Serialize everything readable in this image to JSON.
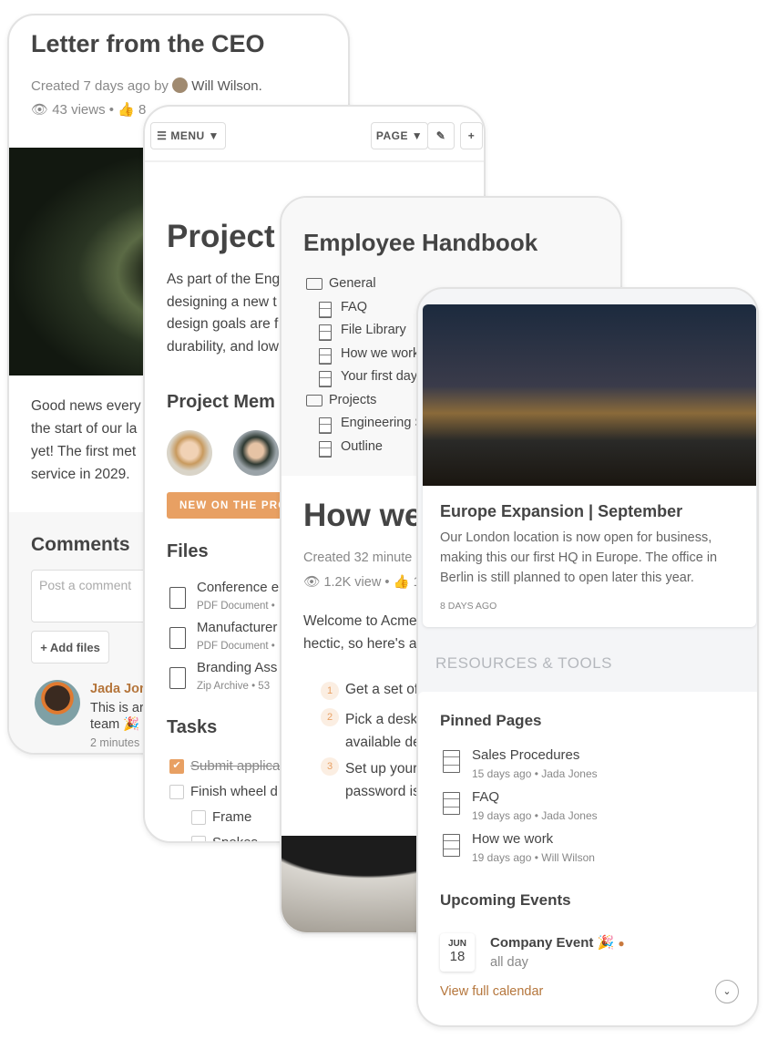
{
  "colors": {
    "accent": "#e8a063",
    "link": "#b5763c",
    "text": "#444444",
    "muted": "#888888"
  },
  "ceo": {
    "title": "Letter from the CEO",
    "created": "Created 7 days ago by",
    "author": "Will Wilson.",
    "views": "43 views •",
    "likes": "8",
    "body": [
      "Good news every",
      "the start of our la",
      "yet! The first met",
      "service in 2029."
    ],
    "comments_title": "Comments",
    "comment_placeholder": "Post a comment",
    "add_files": "+ Add files",
    "comment": {
      "author": "Jada Jon",
      "text": [
        "This is ar",
        "team 🎉"
      ],
      "time": "2 minutes"
    }
  },
  "project": {
    "menu": "MENU ▼",
    "page": "PAGE ▼",
    "pencil_icon": "pencil-icon",
    "plus": "+",
    "title": "Project",
    "body": [
      "As part of the Eng",
      "designing a new t",
      "design goals are f",
      "durability, and low"
    ],
    "members_title": "Project Mem",
    "banner": "NEW ON THE PRO",
    "files_title": "Files",
    "files": [
      {
        "name": "Conference e",
        "meta": "PDF Document •"
      },
      {
        "name": "Manufacturer",
        "meta": "PDF Document •"
      },
      {
        "name": "Branding Ass",
        "meta": "Zip Archive • 53"
      }
    ],
    "tasks_title": "Tasks",
    "tasks": [
      {
        "label": "Submit applica",
        "done": true
      },
      {
        "label": "Finish wheel d",
        "done": false
      },
      {
        "label": "Frame",
        "done": false
      },
      {
        "label": "Spokes",
        "done": false
      }
    ]
  },
  "handbook": {
    "title": "Employee Handbook",
    "tree": [
      {
        "label": "General",
        "type": "folder"
      },
      {
        "label": "FAQ",
        "type": "page"
      },
      {
        "label": "File Library",
        "type": "page"
      },
      {
        "label": "How we work",
        "type": "page"
      },
      {
        "label": "Your first day",
        "type": "page"
      },
      {
        "label": "Projects",
        "type": "folder"
      },
      {
        "label": "Engineering S",
        "type": "page"
      },
      {
        "label": "Outline",
        "type": "page"
      }
    ],
    "page_title": "How we",
    "created": "Created 32 minute",
    "views": "1.2K view •",
    "likes": "1",
    "body": [
      "Welcome to Acme",
      "hectic, so here's a"
    ],
    "steps": [
      {
        "n": "1",
        "lines": [
          "Get a set of"
        ]
      },
      {
        "n": "2",
        "lines": [
          "Pick a desk",
          "available de"
        ]
      },
      {
        "n": "3",
        "lines": [
          "Set up your",
          "password is"
        ]
      }
    ]
  },
  "home": {
    "news": {
      "title": "Europe Expansion | September",
      "body": [
        "Our London location is now open for business,",
        "making this our first HQ in Europe. The office in",
        "Berlin is still planned to open later this year."
      ],
      "time": "8 DAYS AGO"
    },
    "resources": "RESOURCES & TOOLS",
    "pinned_title": "Pinned Pages",
    "pinned": [
      {
        "name": "Sales Procedures",
        "meta": "15 days ago • Jada Jones"
      },
      {
        "name": "FAQ",
        "meta": "19 days ago • Jada Jones"
      },
      {
        "name": "How we work",
        "meta": "19 days ago • Will Wilson"
      }
    ],
    "events_title": "Upcoming Events",
    "event": {
      "month": "JUN",
      "day": "18",
      "title": "Company Event 🎉",
      "time": "all day"
    },
    "calendar_link": "View full calendar"
  }
}
